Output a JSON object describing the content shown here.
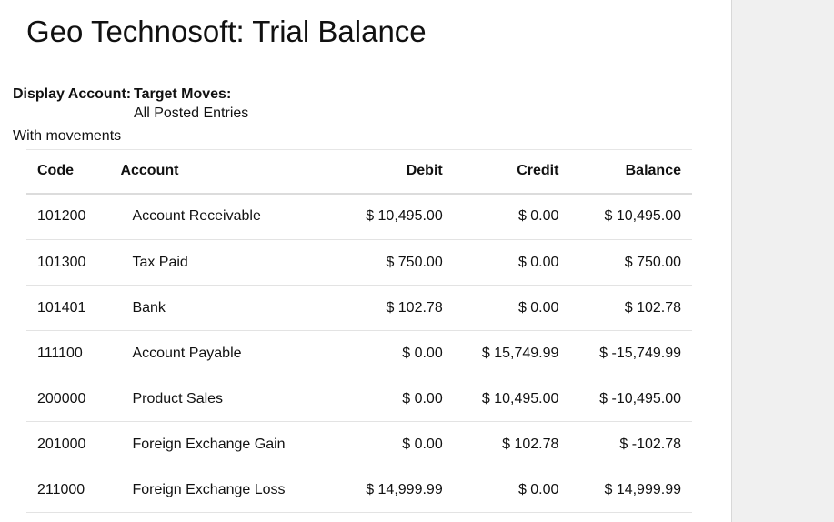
{
  "report": {
    "title": "Geo Technosoft: Trial Balance"
  },
  "filters": {
    "display_account_label": "Display Account:",
    "display_account_value": "With movements",
    "target_moves_label": "Target Moves:",
    "target_moves_value": "All Posted Entries"
  },
  "table": {
    "headers": {
      "code": "Code",
      "account": "Account",
      "debit": "Debit",
      "credit": "Credit",
      "balance": "Balance"
    },
    "rows": [
      {
        "code": "101200",
        "account": "Account Receivable",
        "debit": "$ 10,495.00",
        "credit": "$ 0.00",
        "balance": "$ 10,495.00"
      },
      {
        "code": "101300",
        "account": "Tax Paid",
        "debit": "$ 750.00",
        "credit": "$ 0.00",
        "balance": "$ 750.00"
      },
      {
        "code": "101401",
        "account": "Bank",
        "debit": "$ 102.78",
        "credit": "$ 0.00",
        "balance": "$ 102.78"
      },
      {
        "code": "111100",
        "account": "Account Payable",
        "debit": "$ 0.00",
        "credit": "$ 15,749.99",
        "balance": "$ -15,749.99"
      },
      {
        "code": "200000",
        "account": "Product Sales",
        "debit": "$ 0.00",
        "credit": "$ 10,495.00",
        "balance": "$ -10,495.00"
      },
      {
        "code": "201000",
        "account": "Foreign Exchange Gain",
        "debit": "$ 0.00",
        "credit": "$ 102.78",
        "balance": "$ -102.78"
      },
      {
        "code": "211000",
        "account": "Foreign Exchange Loss",
        "debit": "$ 14,999.99",
        "credit": "$ 0.00",
        "balance": "$ 14,999.99"
      }
    ]
  }
}
